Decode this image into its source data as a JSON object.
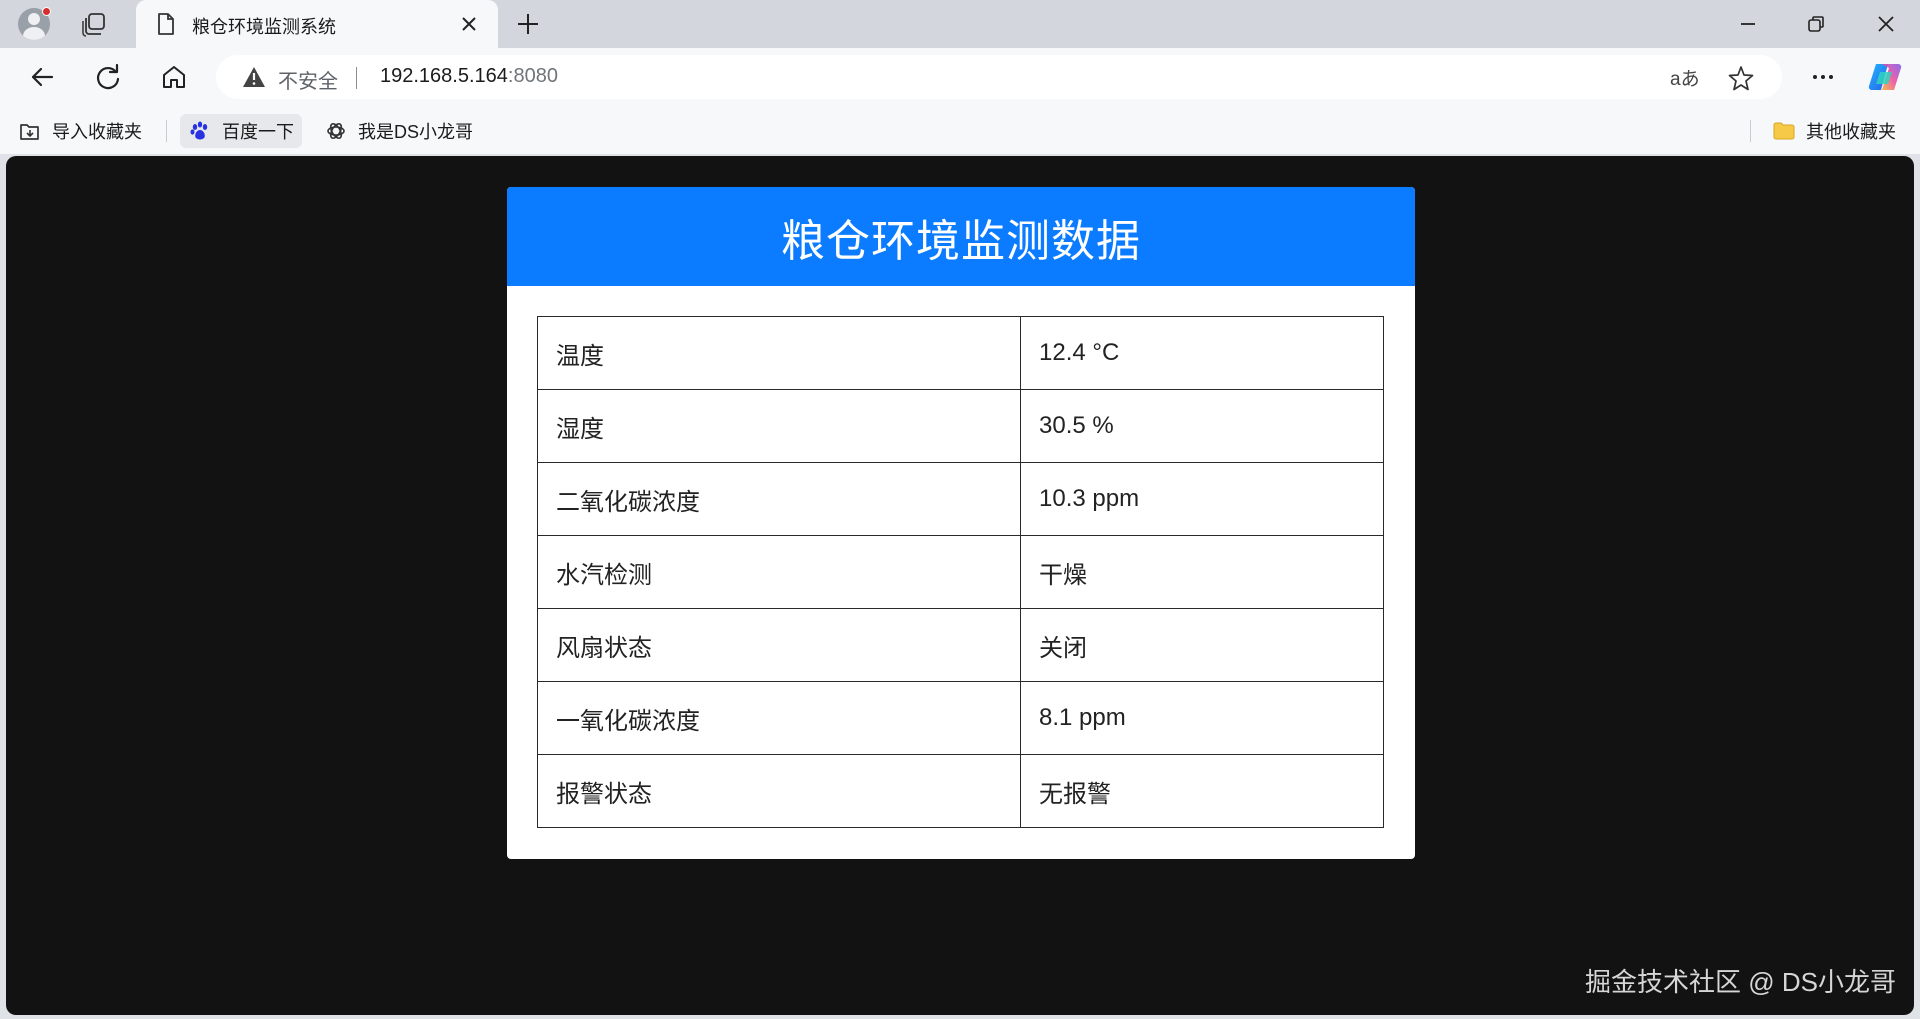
{
  "browser": {
    "tab_title": "粮仓环境监测系统",
    "security_label": "不安全",
    "url_host": "192.168.5.164",
    "url_port": ":8080",
    "read_aloud_glyph": "aあ",
    "bookmarks": [
      {
        "label": "导入收藏夹",
        "icon": "import-favorites-icon"
      },
      {
        "label": "百度一下",
        "icon": "baidu-paw-icon"
      },
      {
        "label": "我是DS小龙哥",
        "icon": "openai-logo-icon"
      }
    ],
    "other_favorites_label": "其他收藏夹"
  },
  "page": {
    "title": "粮仓环境监测数据",
    "rows": [
      {
        "label": "温度",
        "value": "12.4 °C"
      },
      {
        "label": "湿度",
        "value": "30.5 %"
      },
      {
        "label": "二氧化碳浓度",
        "value": "10.3 ppm"
      },
      {
        "label": "水汽检测",
        "value": "干燥"
      },
      {
        "label": "风扇状态",
        "value": "关闭"
      },
      {
        "label": "一氧化碳浓度",
        "value": "8.1 ppm"
      },
      {
        "label": "报警状态",
        "value": "无报警"
      }
    ],
    "watermark": "掘金技术社区 @ DS小龙哥"
  },
  "colors": {
    "header_blue": "#0b7bff",
    "page_background": "#121212"
  }
}
